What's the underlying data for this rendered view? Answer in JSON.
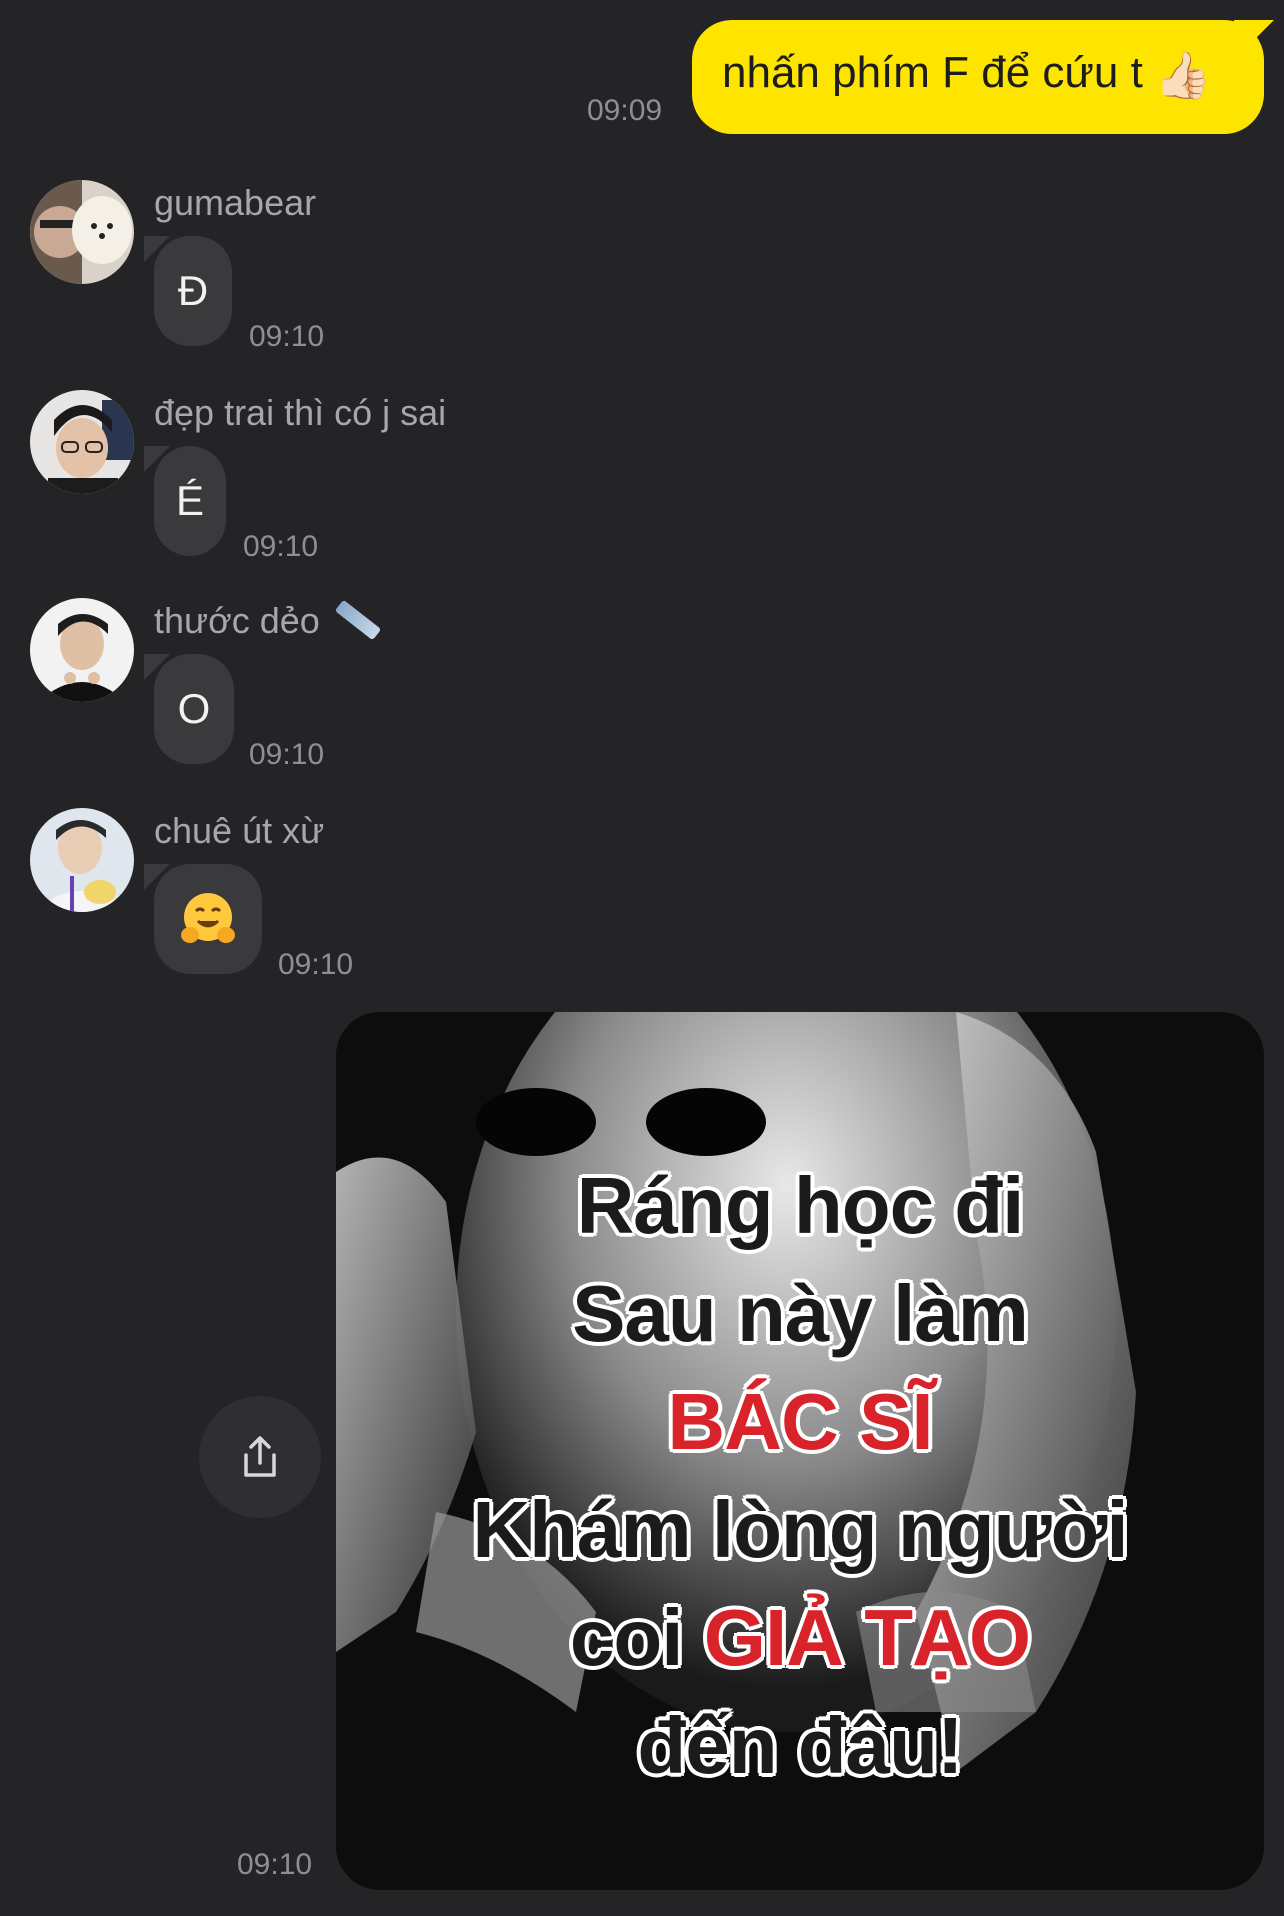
{
  "outgoing_message": {
    "text": "nhấn phím F để cứu t",
    "emoji": "👍🏻",
    "time": "09:09"
  },
  "incoming_messages": [
    {
      "sender": "gumabear",
      "text": "Đ",
      "time": "09:10"
    },
    {
      "sender": "đẹp trai thì có j sai",
      "text": "É",
      "time": "09:10"
    },
    {
      "sender": "thước dẻo",
      "sender_emoji": "ruler-emoji",
      "text": "O",
      "time": "09:10"
    },
    {
      "sender": "chuê út xừ",
      "text_emoji": "hugging-face-emoji",
      "time": "09:10"
    }
  ],
  "image_message": {
    "caption_lines": [
      [
        "Ráng học đi"
      ],
      [
        "Sau này làm"
      ],
      [
        "BÁC SĨ"
      ],
      [
        "Khám lòng người"
      ],
      [
        "coi ",
        "GIẢ TẠO"
      ],
      [
        "đến đâu!"
      ]
    ],
    "time": "09:10",
    "share_icon": "share-icon"
  },
  "colors": {
    "background": "#242427",
    "outgoing_bubble": "#fde500",
    "incoming_bubble": "#3a3a3d",
    "caption_highlight": "#d8232a"
  }
}
